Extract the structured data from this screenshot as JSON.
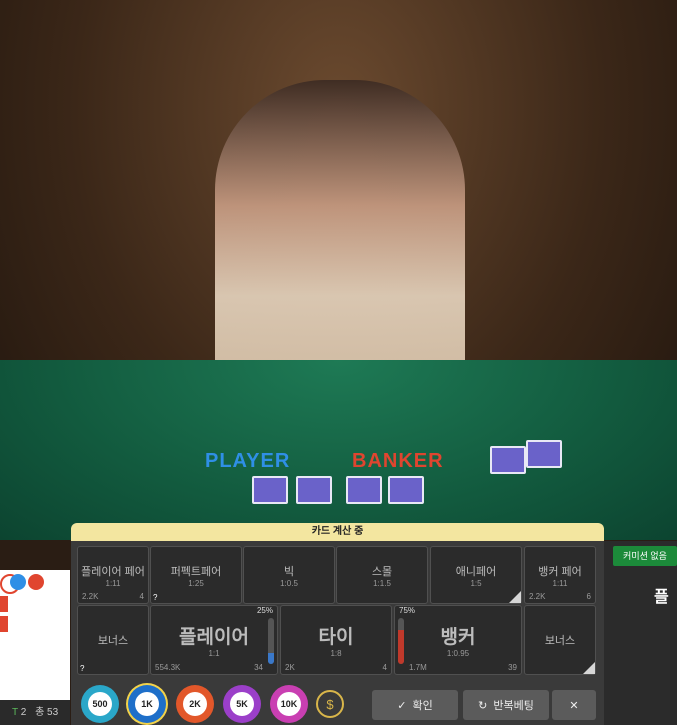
{
  "table_labels": {
    "player": "PLAYER",
    "banker": "BANKER"
  },
  "status": {
    "text": "카드 계산 중"
  },
  "side_bets": [
    {
      "name": "플레이어 페어",
      "odds": "1:11",
      "amount": "2.2K",
      "players": "4"
    },
    {
      "name": "퍼펙트페어",
      "odds": "1:25",
      "amount": "",
      "players": ""
    },
    {
      "name": "빅",
      "odds": "1:0.5",
      "amount": "",
      "players": ""
    },
    {
      "name": "스몰",
      "odds": "1:1.5",
      "amount": "",
      "players": ""
    },
    {
      "name": "애니페어",
      "odds": "1:5",
      "amount": "",
      "players": ""
    },
    {
      "name": "뱅커 페어",
      "odds": "1:11",
      "amount": "2.2K",
      "players": "6"
    }
  ],
  "main_bets": {
    "left_bonus": {
      "name": "보너스"
    },
    "player": {
      "name": "플레이어",
      "odds": "1:1",
      "amount": "554.3K",
      "players": "34",
      "percent": "25%",
      "percent_value": 25
    },
    "tie": {
      "name": "타이",
      "odds": "1:8",
      "amount": "2K",
      "players": "4"
    },
    "banker": {
      "name": "뱅커",
      "odds": "1:0.95",
      "amount": "1.7M",
      "players": "39",
      "percent": "75%",
      "percent_value": 75
    },
    "right_bonus": {
      "name": "보너스"
    }
  },
  "help_mark": "?",
  "chips": [
    {
      "label": "500",
      "color": "#2aa7c9"
    },
    {
      "label": "1K",
      "color": "#1e6fc9"
    },
    {
      "label": "2K",
      "color": "#e2572a"
    },
    {
      "label": "5K",
      "color": "#9b3fc9"
    },
    {
      "label": "10K",
      "color": "#c93fb2"
    }
  ],
  "buttons": {
    "confirm": "확인",
    "repeat": "반복베팅",
    "cancel": "✕"
  },
  "right_panel": {
    "commission_badge": "커미션 없음",
    "title": "플"
  },
  "left_stats": {
    "tie_label": "T",
    "tie_count": "2",
    "total_label": "총",
    "total_count": "53"
  },
  "colors": {
    "player": "#2f8fe6",
    "banker": "#e0452f",
    "banker_meter": "#c0392b",
    "player_meter": "#3a78c9"
  }
}
